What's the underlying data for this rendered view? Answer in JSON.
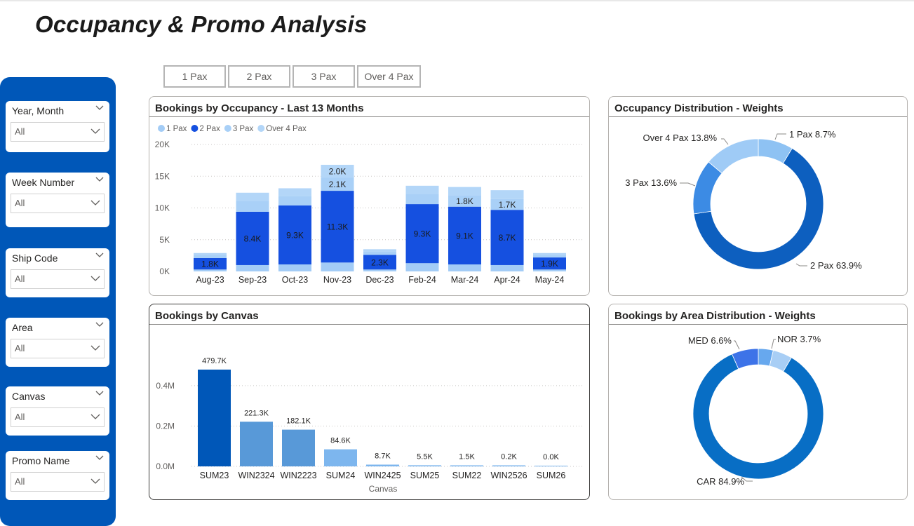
{
  "page": {
    "title": "Occupancy & Promo Analysis"
  },
  "colors": {
    "panel": "#0057b8",
    "pax1": "#9cc8f5",
    "pax2": "#1550e0",
    "pax3": "#a7cff5",
    "pax4": "#a3c9f3",
    "canvas_primary": "#0057b8",
    "canvas_secondary": "#5899d8",
    "canvas_tertiary": "#7db6ee"
  },
  "slicers": [
    {
      "label": "Year, Month",
      "value": "All"
    },
    {
      "label": "Week Number",
      "value": "All"
    },
    {
      "label": "Ship Code",
      "value": "All"
    },
    {
      "label": "Area",
      "value": "All"
    },
    {
      "label": "Canvas",
      "value": "All"
    },
    {
      "label": "Promo Name",
      "value": "All"
    }
  ],
  "pax_buttons": [
    "1 Pax",
    "2 Pax",
    "3 Pax",
    "Over 4 Pax"
  ],
  "cards": {
    "occupancy": "Bookings by Occupancy - Last 13 Months",
    "canvas": "Bookings by Canvas",
    "occ_dist": "Occupancy Distribution - Weights",
    "area_dist": "Bookings by Area Distribution - Weights"
  },
  "chart_data": [
    {
      "id": "occupancy",
      "type": "bar",
      "stacked": true,
      "title": "Bookings by Occupancy - Last 13 Months",
      "categories": [
        "Aug-23",
        "Sep-23",
        "Oct-23",
        "Nov-23",
        "Dec-23",
        "Feb-24",
        "Mar-24",
        "Apr-24",
        "May-24"
      ],
      "series": [
        {
          "name": "1 Pax",
          "color": "#a3ccf6",
          "values": [
            0.3,
            1.0,
            1.1,
            1.4,
            0.3,
            1.3,
            1.1,
            1.0,
            0.3
          ]
        },
        {
          "name": "2 Pax",
          "color": "#1550e0",
          "values": [
            1.8,
            8.4,
            9.3,
            11.3,
            2.3,
            9.3,
            9.1,
            8.7,
            1.9
          ]
        },
        {
          "name": "3 Pax",
          "color": "#a9d0f7",
          "values": [
            0.5,
            1.7,
            1.5,
            2.1,
            0.5,
            1.6,
            1.8,
            1.7,
            0.4
          ]
        },
        {
          "name": "Over 4 Pax",
          "color": "#b3d6f8",
          "values": [
            0.3,
            1.3,
            1.2,
            2.0,
            0.4,
            1.3,
            1.3,
            1.4,
            0.3
          ]
        }
      ],
      "data_labels": [
        [
          "",
          "1.8K",
          "",
          ""
        ],
        [
          "",
          "8.4K",
          "",
          ""
        ],
        [
          "",
          "9.3K",
          "",
          ""
        ],
        [
          "",
          "11.3K",
          "2.1K",
          "2.0K"
        ],
        [
          "",
          "2.3K",
          "",
          ""
        ],
        [
          "",
          "9.3K",
          "",
          ""
        ],
        [
          "",
          "9.1K",
          "1.8K",
          ""
        ],
        [
          "",
          "8.7K",
          "1.7K",
          ""
        ],
        [
          "",
          "1.9K",
          "",
          ""
        ]
      ],
      "y_ticks": [
        "0K",
        "5K",
        "10K",
        "15K",
        "20K"
      ],
      "ylim": [
        0,
        20
      ],
      "grid": true,
      "legend": "top-left"
    },
    {
      "id": "canvas",
      "type": "bar",
      "title": "Bookings by Canvas",
      "xlabel": "Canvas",
      "categories": [
        "SUM23",
        "WIN2324",
        "WIN2223",
        "SUM24",
        "WIN2425",
        "SUM25",
        "SUM22",
        "WIN2526",
        "SUM26"
      ],
      "values": [
        479.7,
        221.3,
        182.1,
        84.6,
        8.7,
        5.5,
        1.5,
        0.2,
        0.0
      ],
      "value_labels": [
        "479.7K",
        "221.3K",
        "182.1K",
        "84.6K",
        "8.7K",
        "5.5K",
        "1.5K",
        "0.2K",
        "0.0K"
      ],
      "y_ticks": [
        "0.0M",
        "0.2M",
        "0.4M"
      ],
      "ylim": [
        0,
        500
      ],
      "grid": true
    },
    {
      "id": "occ_dist",
      "type": "pie",
      "donut": true,
      "title": "Occupancy Distribution - Weights",
      "slices": [
        {
          "name": "1 Pax",
          "value": 8.7,
          "label": "1 Pax 8.7%",
          "color": "#8ec2f3"
        },
        {
          "name": "2 Pax",
          "value": 63.9,
          "label": "2 Pax 63.9%",
          "color": "#0d5fbf"
        },
        {
          "name": "3 Pax",
          "value": 13.6,
          "label": "3 Pax 13.6%",
          "color": "#3c8be4"
        },
        {
          "name": "Over 4 Pax",
          "value": 13.8,
          "label": "Over 4 Pax 13.8%",
          "color": "#9fcbf6"
        }
      ]
    },
    {
      "id": "area_dist",
      "type": "pie",
      "donut": true,
      "title": "Bookings by Area Distribution - Weights",
      "slices": [
        {
          "name": "NOR",
          "value": 3.7,
          "label": "NOR 3.7%",
          "color": "#67a8ee"
        },
        {
          "name": "other",
          "value": 4.8,
          "label": "",
          "color": "#a8cef5"
        },
        {
          "name": "CAR",
          "value": 84.9,
          "label": "CAR 84.9%",
          "color": "#086ec5"
        },
        {
          "name": "MED",
          "value": 6.6,
          "label": "MED 6.6%",
          "color": "#3d73e8"
        }
      ]
    }
  ]
}
